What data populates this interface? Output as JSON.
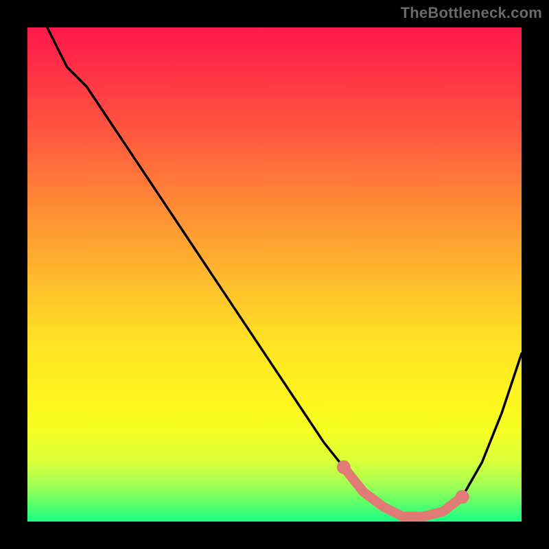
{
  "watermark": "TheBottleneck.com",
  "chart_data": {
    "type": "line",
    "title": "",
    "xlabel": "",
    "ylabel": "",
    "xlim": [
      0,
      100
    ],
    "ylim": [
      0,
      100
    ],
    "grid": false,
    "series": [
      {
        "name": "bottleneck-curve",
        "x": [
          4,
          8,
          12,
          16,
          20,
          24,
          28,
          32,
          36,
          40,
          44,
          48,
          52,
          56,
          60,
          64,
          68,
          72,
          76,
          80,
          84,
          88,
          92,
          96,
          100
        ],
        "values": [
          100,
          92,
          88,
          82,
          76,
          70,
          64,
          58,
          52,
          46,
          40,
          34,
          28,
          22,
          16,
          11,
          6,
          3,
          1,
          1,
          2,
          5,
          12,
          22,
          34
        ]
      }
    ],
    "highlight_zone": {
      "name": "optimal-range",
      "x": [
        64,
        68,
        72,
        76,
        80,
        84,
        88
      ],
      "values": [
        11,
        6,
        3,
        1,
        1,
        2,
        5
      ]
    },
    "colors": {
      "curve": "#000000",
      "highlight": "#e07a74",
      "top_gradient": "#ff1a4a",
      "bottom_gradient": "#18ff84"
    }
  }
}
